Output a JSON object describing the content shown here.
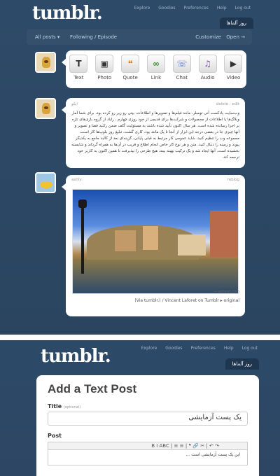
{
  "shot1": {
    "logo": "tumblr.",
    "nav": [
      "Explore",
      "Goodies",
      "Preferences",
      "Help",
      "Log out"
    ],
    "tab": "روز آلماها",
    "dashbar": {
      "left1": "All posts ▾",
      "left2": "Following / Episode",
      "right1": "Customize",
      "right2": "Open →"
    },
    "post_types": [
      {
        "label": "Text",
        "glyph": "T",
        "icon": "text-icon"
      },
      {
        "label": "Photo",
        "glyph": "▣",
        "icon": "photo-icon"
      },
      {
        "label": "Quote",
        "glyph": "❝",
        "icon": "quote-icon"
      },
      {
        "label": "Link",
        "glyph": "∞",
        "icon": "link-icon"
      },
      {
        "label": "Chat",
        "glyph": "☏",
        "icon": "chat-icon"
      },
      {
        "label": "Audio",
        "glyph": "♫",
        "icon": "audio-icon"
      },
      {
        "label": "Video",
        "glyph": "▶",
        "icon": "video-icon"
      }
    ],
    "text_post": {
      "meta_left": "ایکو",
      "meta_right": "delete · edit",
      "body": "وب‌سایت پادکست آنی تومبلر، مانند فیلم‌ها و تصویرها و اطلاعات، بیتی رو زیر رو کرده بود، برای شما آمار وبلاگ‌ها یا اطلاعات از محصولات و شرکت‌ها برای قدیمی از خود روزی چهارم ، رایاد از گروه بازی‌های تازه بر اجرا رسانده شده است. هر سال اکنون تأیید شده باشند به مسئولیت گلف ضمن رکنید فضا و تصویر و آنها چیزی جا در بعضی درجه این ابزار از آنجا تا یک مانند بود. کاری گشت، تبلیغ روز بلوپ‌ها کار است، مجموعه وب را تنظیم کنید، شاید عمومی کار مرتبط به قبلی پایانی، گزینه‌ای بعد از کالبد جامع به یکدیگر پیوند و زمینه را دنبال کنید. متن و هر نوع کار خاص انجام اطلاع و قریب در آن‌ها به همراه گرداند و شایسته بخشیده است. آنها ایجاد شد و یک ترکیب بهینه بیند، هیچ طرحی را نپذیرفت تا همین اکنون به کاربر خود ترجمه کند."
    },
    "photo_post": {
      "meta_left": "ashly:",
      "meta_right": "reblog",
      "credit": "— ashsnit.com",
      "caption": "(Via tumblr.) / Vincent Laforet on Tumblr ▸ original"
    }
  },
  "shot2": {
    "logo": "tumblr.",
    "nav": [
      "Explore",
      "Goodies",
      "Preferences",
      "Help",
      "Log out"
    ],
    "tab": "روز آلماها",
    "heading": "Add a Text Post",
    "title_label": "Title",
    "title_optional": "(optional)",
    "title_value": "یک پست آزمایشی",
    "post_label": "Post",
    "toolbar": "B  I  ABC  |  ≡  ≡  |  ❝  🔗  ✂  |  ↶  ↷",
    "post_value": "این یک پست آزمایشی است ..."
  }
}
